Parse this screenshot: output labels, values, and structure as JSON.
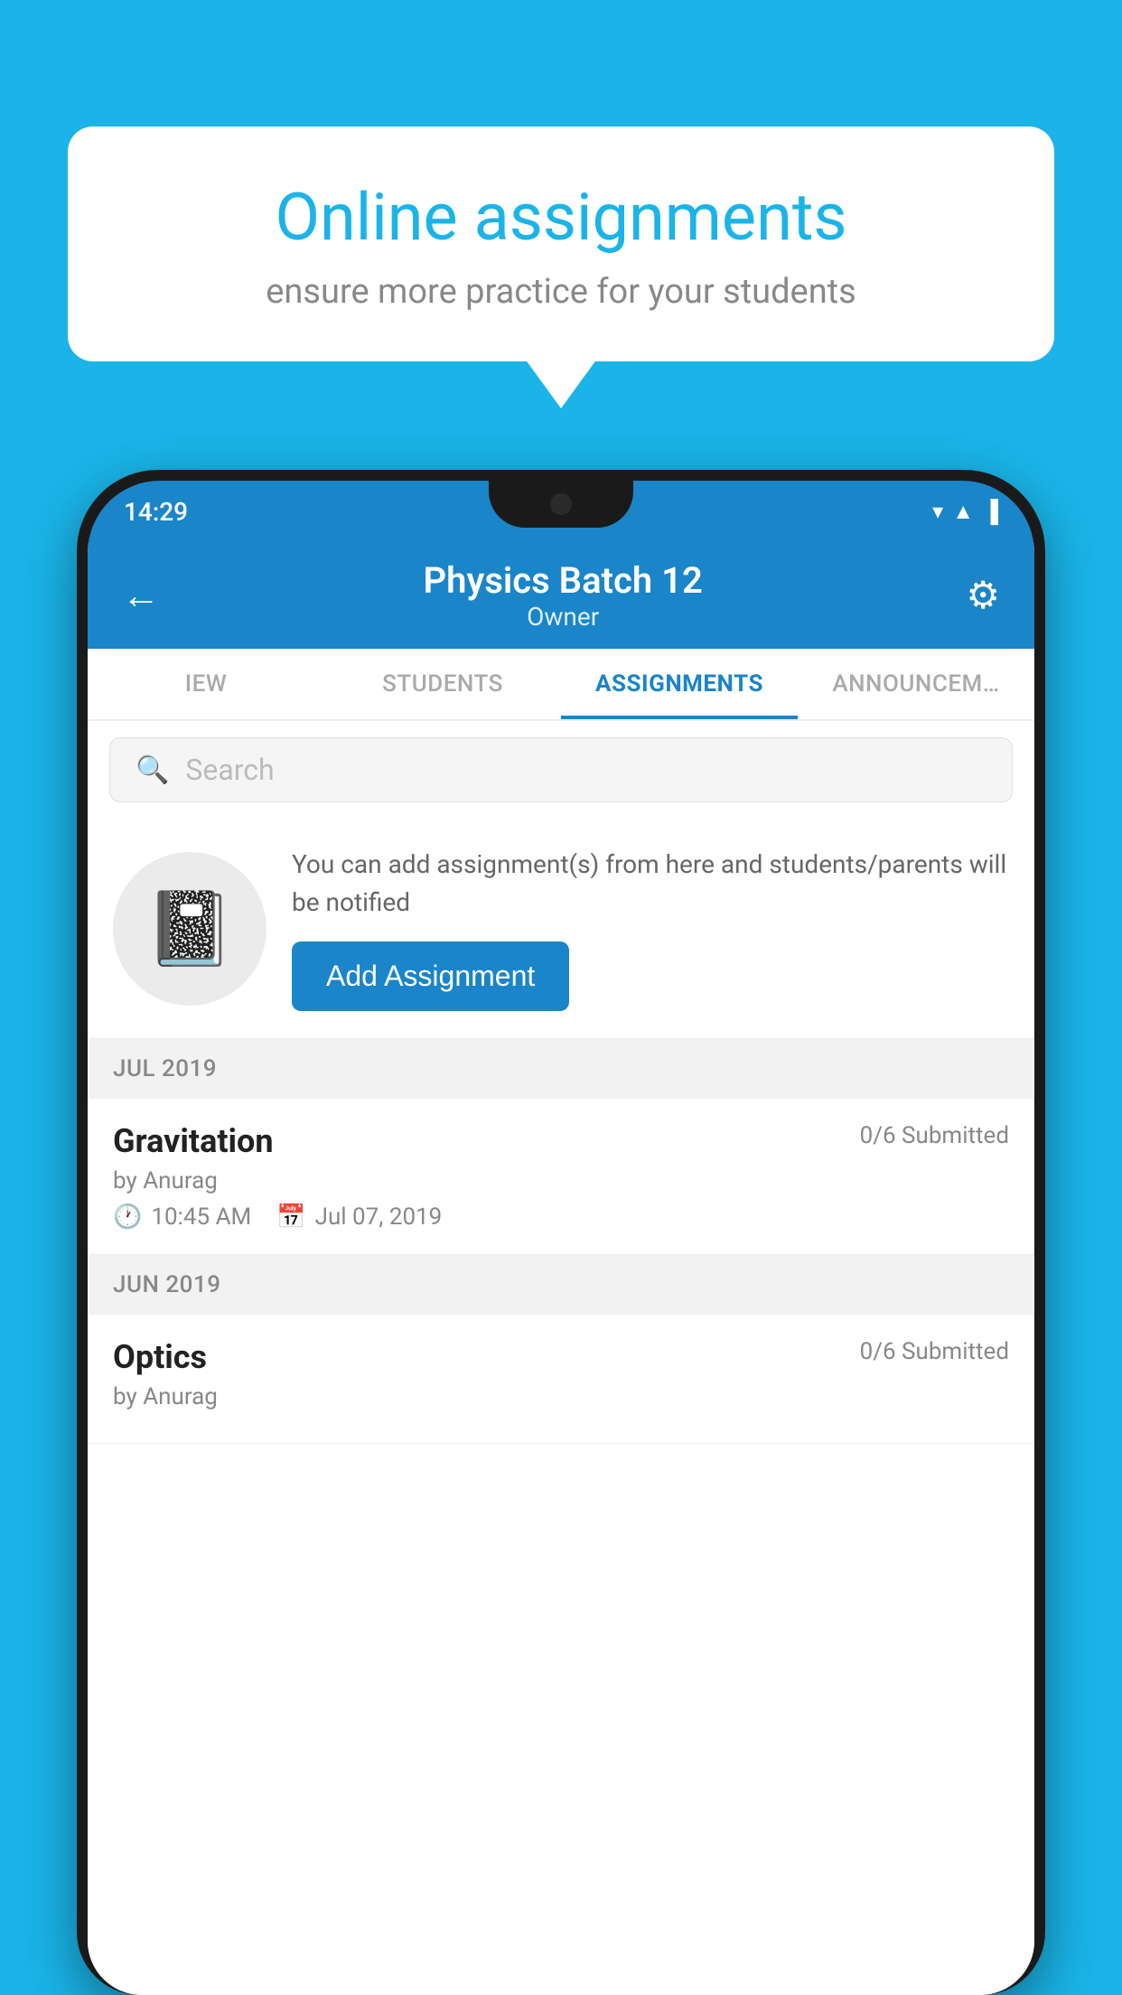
{
  "background_color": "#1ab4e8",
  "speech_bubble": {
    "title": "Online assignments",
    "subtitle": "ensure more practice for your students"
  },
  "status_bar": {
    "time": "14:29",
    "icons": [
      "wifi",
      "signal",
      "battery"
    ]
  },
  "app_header": {
    "title": "Physics Batch 12",
    "subtitle": "Owner",
    "back_label": "←",
    "settings_label": "⚙"
  },
  "tabs": [
    {
      "label": "IEW",
      "active": false
    },
    {
      "label": "STUDENTS",
      "active": false
    },
    {
      "label": "ASSIGNMENTS",
      "active": true
    },
    {
      "label": "ANNOUNCEM…",
      "active": false
    }
  ],
  "search": {
    "placeholder": "Search"
  },
  "promo": {
    "description": "You can add assignment(s) from here and students/parents will be notified",
    "button_label": "Add Assignment"
  },
  "sections": [
    {
      "month_label": "JUL 2019",
      "assignments": [
        {
          "title": "Gravitation",
          "submitted": "0/6 Submitted",
          "by": "by Anurag",
          "time": "10:45 AM",
          "date": "Jul 07, 2019"
        }
      ]
    },
    {
      "month_label": "JUN 2019",
      "assignments": [
        {
          "title": "Optics",
          "submitted": "0/6 Submitted",
          "by": "by Anurag",
          "time": "",
          "date": ""
        }
      ]
    }
  ]
}
